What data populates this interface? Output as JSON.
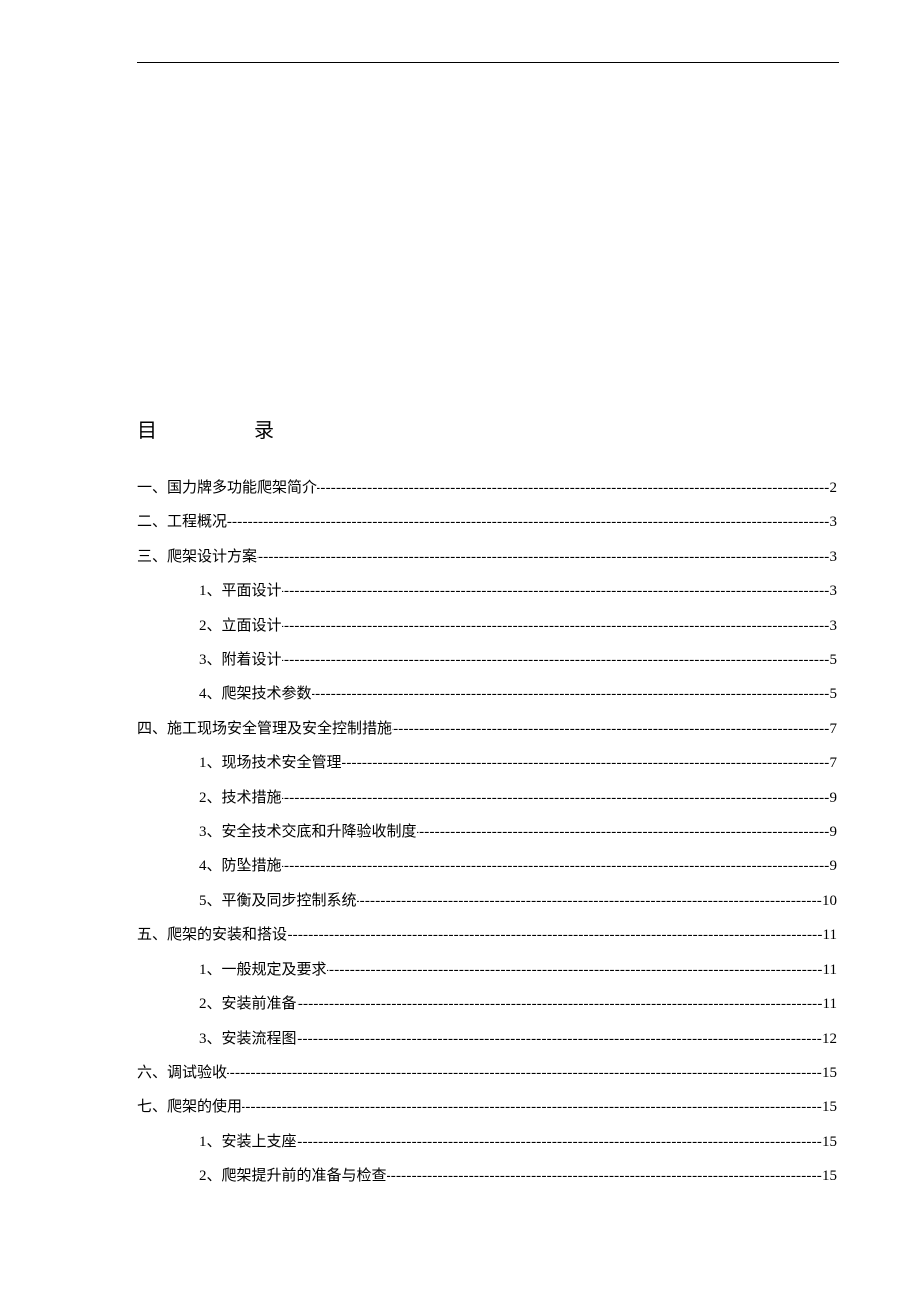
{
  "title": {
    "char1": "目",
    "char2": "录"
  },
  "toc": [
    {
      "level": 1,
      "label": "一、国力牌多功能爬架简介",
      "page": "2"
    },
    {
      "level": 1,
      "label": "二、工程概况",
      "page": "3"
    },
    {
      "level": 1,
      "label": "三、爬架设计方案",
      "page": "3"
    },
    {
      "level": 2,
      "label": "1、平面设计",
      "page": "3"
    },
    {
      "level": 2,
      "label": "2、立面设计",
      "page": "3"
    },
    {
      "level": 2,
      "label": "3、附着设计",
      "page": "5"
    },
    {
      "level": 2,
      "label": "4、爬架技术参数",
      "page": "5"
    },
    {
      "level": 1,
      "label": "四、施工现场安全管理及安全控制措施",
      "page": "7"
    },
    {
      "level": 2,
      "label": "1、现场技术安全管理",
      "page": "7"
    },
    {
      "level": 2,
      "label": "2、技术措施",
      "page": "9"
    },
    {
      "level": 2,
      "label": "3、安全技术交底和升降验收制度",
      "page": "9"
    },
    {
      "level": 2,
      "label": "4、防坠措施",
      "page": "9"
    },
    {
      "level": 2,
      "label": "5、平衡及同步控制系统",
      "page": "10"
    },
    {
      "level": 1,
      "label": "五、爬架的安装和搭设",
      "page": "11"
    },
    {
      "level": 2,
      "label": "1、一般规定及要求",
      "page": "11"
    },
    {
      "level": 2,
      "label": "2、安装前准备",
      "page": "11"
    },
    {
      "level": 2,
      "label": "3、安装流程图",
      "page": "12"
    },
    {
      "level": 1,
      "label": "六、调试验收",
      "page": "15"
    },
    {
      "level": 1,
      "label": "七、爬架的使用",
      "page": "15"
    },
    {
      "level": 2,
      "label": "1、安装上支座",
      "page": "15"
    },
    {
      "level": 2,
      "label": "2、爬架提升前的准备与检查",
      "page": "15"
    }
  ]
}
